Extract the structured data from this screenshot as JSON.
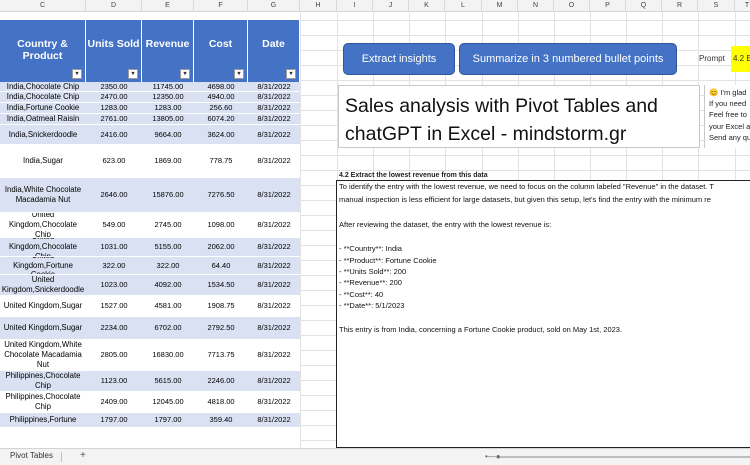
{
  "columns": [
    "C",
    "D",
    "E",
    "F",
    "G",
    "H",
    "I",
    "J",
    "K",
    "L",
    "M",
    "N",
    "O",
    "P",
    "Q",
    "R",
    "S",
    "T"
  ],
  "table": {
    "headers": [
      "Country & Product",
      "Units Sold",
      "Revenue",
      "Cost",
      "Date"
    ],
    "rows": [
      [
        "India,Chocolate Chip",
        "2350.00",
        "11745.00",
        "4698.00",
        "8/31/2022"
      ],
      [
        "India,Chocolate Chip",
        "2470.00",
        "12350.00",
        "4940.00",
        "8/31/2022"
      ],
      [
        "India,Fortune Cookie",
        "1283.00",
        "1283.00",
        "256.60",
        "8/31/2022"
      ],
      [
        "India,Oatmeal Raisin",
        "2761.00",
        "13805.00",
        "6074.20",
        "8/31/2022"
      ],
      [
        "India,Snickerdoodle",
        "2416.00",
        "9664.00",
        "3624.00",
        "8/31/2022"
      ],
      [
        "India,Sugar",
        "623.00",
        "1869.00",
        "778.75",
        "8/31/2022"
      ],
      [
        "India,White Chocolate Macadamia Nut",
        "2646.00",
        "15876.00",
        "7276.50",
        "8/31/2022"
      ],
      [
        "United Kingdom,Chocolate Chip",
        "549.00",
        "2745.00",
        "1098.00",
        "8/31/2022"
      ],
      [
        "United Kingdom,Chocolate Chip",
        "1031.00",
        "5155.00",
        "2062.00",
        "8/31/2022"
      ],
      [
        "United Kingdom,Fortune Cookie",
        "322.00",
        "322.00",
        "64.40",
        "8/31/2022"
      ],
      [
        "United Kingdom,Snickerdoodle",
        "1023.00",
        "4092.00",
        "1534.50",
        "8/31/2022"
      ],
      [
        "United Kingdom,Sugar",
        "1527.00",
        "4581.00",
        "1908.75",
        "8/31/2022"
      ],
      [
        "United Kingdom,Sugar",
        "2234.00",
        "6702.00",
        "2792.50",
        "8/31/2022"
      ],
      [
        "United Kingdom,White Chocolate Macadamia Nut",
        "2805.00",
        "16830.00",
        "7713.75",
        "8/31/2022"
      ],
      [
        "Philippines,Chocolate Chip",
        "1123.00",
        "5615.00",
        "2246.00",
        "8/31/2022"
      ],
      [
        "Philippines,Chocolate Chip",
        "2409.00",
        "12045.00",
        "4818.00",
        "8/31/2022"
      ],
      [
        "Philippines,Fortune",
        "1797.00",
        "1797.00",
        "359.40",
        "8/31/2022"
      ]
    ]
  },
  "buttons": {
    "extract": "Extract insights",
    "summarize": "Summarize in 3 numbered bullet points"
  },
  "prompt": {
    "label": "Prompt",
    "value": "4.2 Ex"
  },
  "title": {
    "line1": "Sales analysis with Pivot Tables and",
    "line2": "chatGPT in Excel - mindstorm.gr"
  },
  "chat_snippet": [
    "😊 I'm glad",
    "If you need",
    "Feel free to",
    "your Excel a",
    "Send any qu"
  ],
  "result": {
    "heading": "4.2 Extract the lowest revenue from this data",
    "lines": [
      "To identify the entry with the lowest revenue, we need to focus on the column labeled \"Revenue\" in the dataset. T",
      "manual inspection is less efficient for large datasets, but given this setup, let's find the entry with the minimum re",
      "",
      "After reviewing the dataset, the entry with the lowest revenue is:",
      "",
      "- **Country**: India",
      "- **Product**: Fortune Cookie",
      "- **Units Sold**: 200",
      "- **Revenue**: 200",
      "- **Cost**: 40",
      "- **Date**: 5/1/2023",
      "",
      "This entry is from India, concerning a Fortune Cookie product, sold on May 1st, 2023."
    ]
  },
  "sheet": {
    "tab": "Pivot Tables",
    "add": "+"
  },
  "colors": {
    "header_blue": "#4472c4",
    "band_blue": "#d9e1f2",
    "prompt_yellow": "#ffff00"
  }
}
